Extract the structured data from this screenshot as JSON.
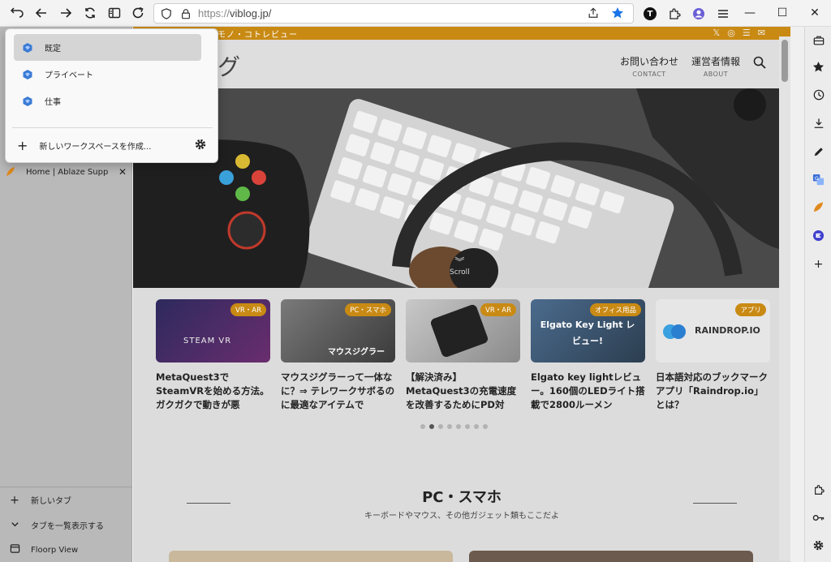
{
  "toolbar": {
    "url_scheme": "https://",
    "url_host": "viblog.jp/",
    "profile_letter": "T"
  },
  "workspace_menu": {
    "items": [
      {
        "label": "既定",
        "selected": true
      },
      {
        "label": "プライベート",
        "selected": false
      },
      {
        "label": "仕事",
        "selected": false
      }
    ],
    "create_label": "新しいワークスペースを作成..."
  },
  "sidebar": {
    "tab": {
      "label": "Home | Ablaze Supp"
    },
    "bottom": [
      {
        "icon": "plus-icon",
        "label": "新しいタブ"
      },
      {
        "icon": "chevron-down-icon",
        "label": "タブを一覧表示する"
      },
      {
        "icon": "floorp-view-icon",
        "label": "Floorp View"
      }
    ]
  },
  "page": {
    "topstrip_text": "モノ・コトレビュー",
    "logo_text": "グ",
    "nav": [
      {
        "jp": "お問い合わせ",
        "en": "CONTACT"
      },
      {
        "jp": "運営者情報",
        "en": "ABOUT"
      }
    ],
    "scroll_label": "Scroll",
    "cards": [
      {
        "badge": "VR・AR",
        "thumb_text": "STEAM VR",
        "title": "MetaQuest3でSteamVRを始める方法。ガクガクで動きが悪",
        "color": "#3b2a6e"
      },
      {
        "badge": "PC・スマホ",
        "thumb_text": "マウスジグラー",
        "title": "マウスジグラーって一体なに？⇒ テレワークサボるのに最適なアイテムで",
        "color": "#5a5a5a"
      },
      {
        "badge": "VR・AR",
        "thumb_text": "",
        "title": "【解決済み】MetaQuest3の充電速度を改善するためにPD対",
        "color": "#8a8a8a"
      },
      {
        "badge": "オフィス用品",
        "thumb_text": "Elgato Key Light レビュー!",
        "title": "Elgato key lightレビュー。160個のLEDライト搭載で2800ルーメン",
        "color": "#3d5a7a"
      },
      {
        "badge": "アプリ",
        "thumb_text": "RAINDROP.IO",
        "title": "日本語対応のブックマークアプリ「Raindrop.io」とは？",
        "color": "#e4e4e4"
      }
    ],
    "dots_count": 8,
    "dots_active": 1,
    "section_title": "PC・スマホ",
    "section_sub": "キーボードやマウス、その他ガジェット類もここだよ"
  },
  "colors": {
    "accent": "#c98a14",
    "bookmark_star": "#1a73e8"
  }
}
